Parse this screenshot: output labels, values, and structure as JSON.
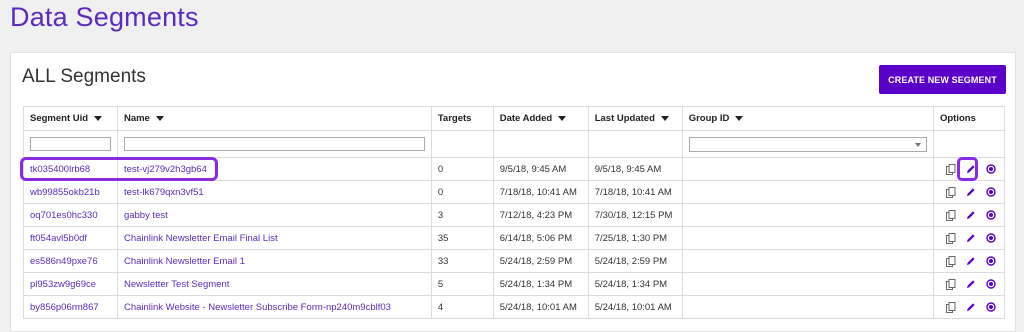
{
  "page_title": "Data Segments",
  "panel": {
    "title": "ALL Segments",
    "create_button_label": "CREATE NEW SEGMENT"
  },
  "columns": {
    "uid": "Segment Uid",
    "name": "Name",
    "targets": "Targets",
    "date_added": "Date Added",
    "last_updated": "Last Updated",
    "group_id": "Group ID",
    "options": "Options"
  },
  "rows": [
    {
      "uid": "tk035400lrb68",
      "name": "test-vj279v2h3gb64",
      "targets": "0",
      "date_added": "9/5/18, 9:45 AM",
      "last_updated": "9/5/18, 9:45 AM"
    },
    {
      "uid": "wb99855okb21b",
      "name": "test-lk679qxn3vf51",
      "targets": "0",
      "date_added": "7/18/18, 10:41 AM",
      "last_updated": "7/18/18, 10:41 AM"
    },
    {
      "uid": "oq701es0hc330",
      "name": "gabby test",
      "targets": "3",
      "date_added": "7/12/18, 4:23 PM",
      "last_updated": "7/30/18, 12:15 PM"
    },
    {
      "uid": "ft054avl5b0df",
      "name": "Chainlink Newsletter Email Final List",
      "targets": "35",
      "date_added": "6/14/18, 5:06 PM",
      "last_updated": "7/25/18, 1:30 PM"
    },
    {
      "uid": "es586n49pxe76",
      "name": "Chainlink Newsletter Email 1",
      "targets": "33",
      "date_added": "5/24/18, 2:59 PM",
      "last_updated": "5/24/18, 2:59 PM"
    },
    {
      "uid": "pl953zw9g69ce",
      "name": "Newsletter Test Segment",
      "targets": "5",
      "date_added": "5/24/18, 1:34 PM",
      "last_updated": "5/24/18, 1:34 PM"
    },
    {
      "uid": "by856p06rm867",
      "name": "Chainlink Website - Newsletter Subscribe Form-np240m9cblf03",
      "targets": "4",
      "date_added": "5/24/18, 10:01 AM",
      "last_updated": "5/24/18, 10:01 AM"
    }
  ],
  "colors": {
    "accent": "#5a00c8",
    "link": "#5b2bbf",
    "highlight": "#8a2be2"
  },
  "icons": [
    "copy-icon",
    "edit-icon",
    "view-icon"
  ]
}
